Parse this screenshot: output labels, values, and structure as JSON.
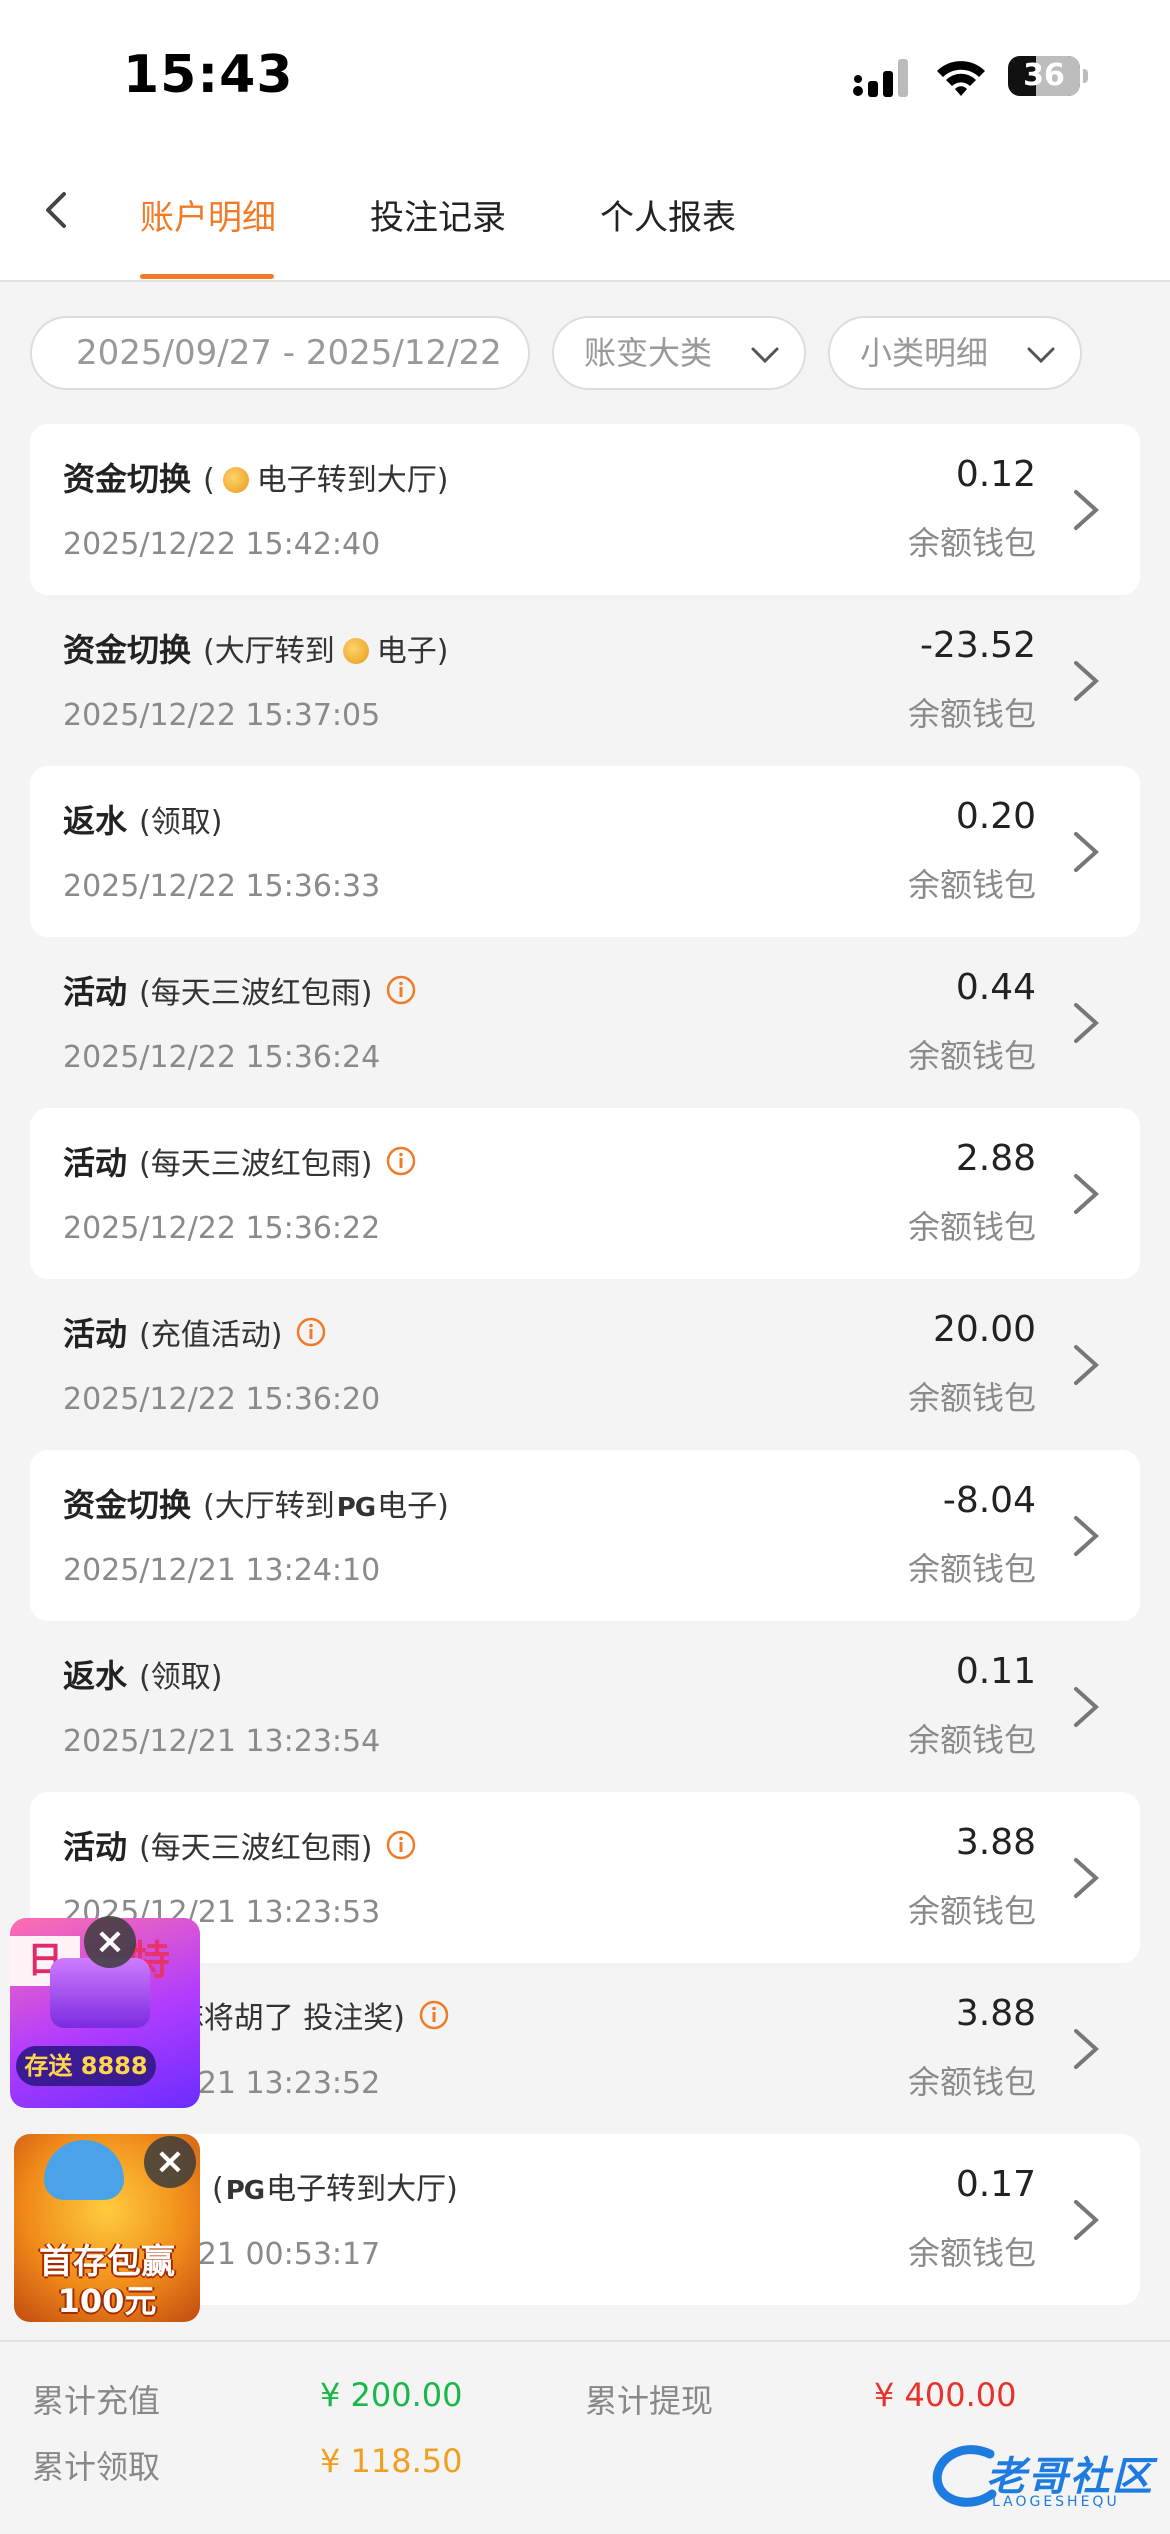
{
  "status_bar": {
    "time": "15:43",
    "battery": "36"
  },
  "nav": {
    "tabs": [
      {
        "label": "账户明细",
        "active": true
      },
      {
        "label": "投注记录",
        "active": false
      },
      {
        "label": "个人报表",
        "active": false
      }
    ]
  },
  "filters": {
    "date_range": "2025/09/27 - 2025/12/22",
    "category": "账变大类",
    "subcategory": "小类明细"
  },
  "transactions": [
    {
      "title": "资金切换",
      "detail_pre": "(",
      "detail_post": "电子转到大厅)",
      "datetime": "2025/12/22 15:42:40",
      "amount": "0.12",
      "wallet": "余额钱包"
    },
    {
      "title": "资金切换",
      "detail_pre": "(大厅转到",
      "detail_post": "电子)",
      "datetime": "2025/12/22 15:37:05",
      "amount": "-23.52",
      "wallet": "余额钱包"
    },
    {
      "title": "返水",
      "detail": "(领取)",
      "datetime": "2025/12/22 15:36:33",
      "amount": "0.20",
      "wallet": "余额钱包"
    },
    {
      "title": "活动",
      "detail": "(每天三波红包雨)",
      "datetime": "2025/12/22 15:36:24",
      "amount": "0.44",
      "wallet": "余额钱包"
    },
    {
      "title": "活动",
      "detail": "(每天三波红包雨)",
      "datetime": "2025/12/22 15:36:22",
      "amount": "2.88",
      "wallet": "余额钱包"
    },
    {
      "title": "活动",
      "detail": "(充值活动)",
      "datetime": "2025/12/22 15:36:20",
      "amount": "20.00",
      "wallet": "余额钱包"
    },
    {
      "title": "资金切换",
      "detail_pre": "(大厅转到",
      "pg_logo": "PG",
      "detail_post": "电子)",
      "datetime": "2025/12/21 13:24:10",
      "amount": "-8.04",
      "wallet": "余额钱包"
    },
    {
      "title": "返水",
      "detail": "(领取)",
      "datetime": "2025/12/21 13:23:54",
      "amount": "0.11",
      "wallet": "余额钱包"
    },
    {
      "title": "活动",
      "detail": "(每天三波红包雨)",
      "datetime": "2025/12/21 13:23:53",
      "amount": "3.88",
      "wallet": "余额钱包"
    },
    {
      "title": "",
      "detail": "(麻将胡了 投注奖)",
      "datetime": "2025/12/21 13:23:52",
      "amount": "3.88",
      "wallet": "余额钱包"
    },
    {
      "title": "",
      "detail_pre": "(",
      "pg_logo": "PG",
      "detail_post": "电子转到大厅)",
      "datetime": "2025/12/21 00:53:17",
      "amount": "0.17",
      "wallet": "余额钱包"
    }
  ],
  "summary": {
    "total_deposit_label": "累计充值",
    "total_deposit_value": "¥ 200.00",
    "total_withdraw_label": "累计提现",
    "total_withdraw_value": "¥ 400.00",
    "total_claim_label": "累计领取",
    "total_claim_value": "¥ 118.50"
  },
  "ads": {
    "promo1_text": "存送 8888",
    "promo2_line1": "首存包赢",
    "promo2_line2": "100元"
  },
  "watermark": {
    "text": "老哥社区",
    "sub": "LAOGESHEQU"
  },
  "colors": {
    "accent": "#f07b28",
    "green": "#19b84a",
    "red": "#e8332a",
    "gold": "#f0a020"
  }
}
